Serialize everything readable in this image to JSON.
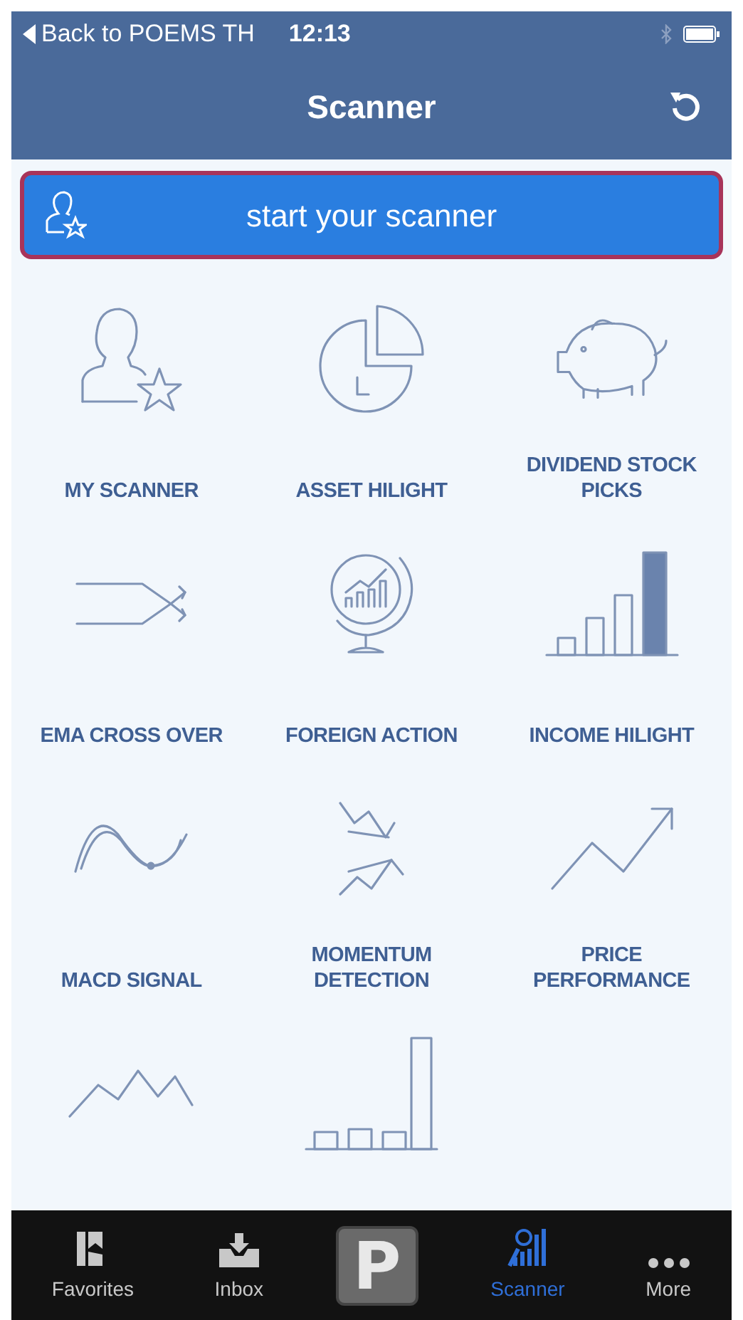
{
  "status_bar": {
    "back_label": "Back to POEMS TH",
    "time": "12:13"
  },
  "nav_bar": {
    "title": "Scanner"
  },
  "start_button": {
    "label": "start your scanner"
  },
  "scanners": [
    {
      "kind": "labeled",
      "label": "MY SCANNER"
    },
    {
      "kind": "labeled",
      "label": "ASSET HILIGHT"
    },
    {
      "kind": "labeled",
      "label": "DIVIDEND STOCK PICKS"
    },
    {
      "kind": "labeled",
      "label": "EMA CROSS OVER"
    },
    {
      "kind": "labeled",
      "label": "FOREIGN ACTION"
    },
    {
      "kind": "labeled",
      "label": "INCOME HILIGHT"
    },
    {
      "kind": "labeled",
      "label": "MACD SIGNAL"
    },
    {
      "kind": "labeled",
      "label": "MOMENTUM DETECTION"
    },
    {
      "kind": "labeled",
      "label": "PRICE PERFORMANCE"
    },
    {
      "kind": "icon_only"
    },
    {
      "kind": "icon_only"
    }
  ],
  "tab_bar": [
    {
      "kind": "tab",
      "label": "Favorites",
      "selected": false
    },
    {
      "kind": "tab",
      "label": "Inbox",
      "selected": false
    },
    {
      "kind": "logo",
      "text": "P",
      "selected": false
    },
    {
      "kind": "tab",
      "label": "Scanner",
      "selected": true
    },
    {
      "kind": "tab",
      "label": "More",
      "selected": false
    }
  ]
}
